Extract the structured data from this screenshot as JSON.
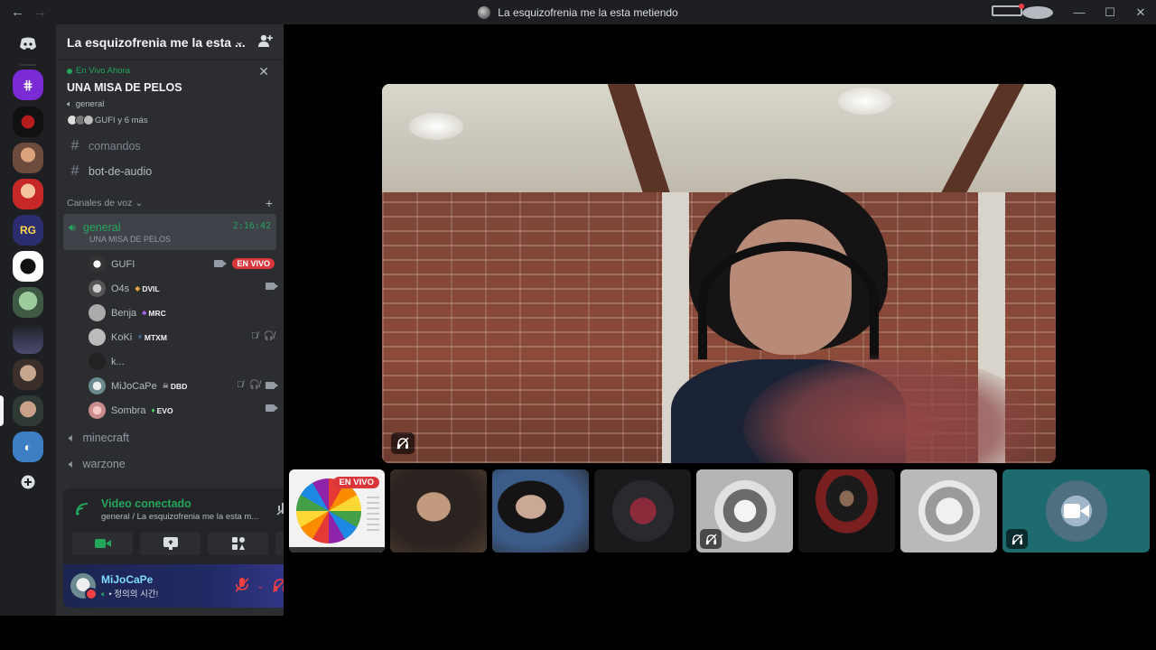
{
  "window": {
    "title": "La esquizofrenia me la esta metiendo"
  },
  "server": {
    "name": "La esquizofrenia me la esta ..."
  },
  "live_now": {
    "label": "En Vivo Ahora",
    "activity": "UNA MISA DE PELOS",
    "channel": "general",
    "participants": "GUFI y 6 más"
  },
  "text_channels": [
    {
      "name": "comandos"
    },
    {
      "name": "bot-de-audio"
    }
  ],
  "voice_category": {
    "label": "Canales de voz"
  },
  "active_voice": {
    "name": "general",
    "timer": "2:16:42",
    "activity": "UNA MISA DE PELOS"
  },
  "members": [
    {
      "name": "GUFI",
      "tag": "",
      "live": "EN VIVO"
    },
    {
      "name": "O4s",
      "tag": "DVIL"
    },
    {
      "name": "Benja",
      "tag": "MRC"
    },
    {
      "name": "KoKi",
      "tag": "MTXM"
    },
    {
      "name": "k...",
      "tag": ""
    },
    {
      "name": "MiJoCaPe",
      "tag": "DBD"
    },
    {
      "name": "Sombra",
      "tag": "EVO"
    }
  ],
  "other_voice": [
    {
      "name": "minecraft"
    },
    {
      "name": "warzone"
    }
  ],
  "voice_status": {
    "status": "Video conectado",
    "location": "general / La esquizofrenia me la esta m..."
  },
  "user": {
    "name": "MiJoCaPe",
    "status": "• 정의의 시간!"
  },
  "stage": {
    "tile_live_label": "EN VIVO"
  },
  "colors": {
    "accent_green": "#23a55a",
    "live_red": "#da373c",
    "sidebar_bg": "#2b2d31",
    "rail_bg": "#1e1f22",
    "teal_tile": "#1d6b6e"
  }
}
